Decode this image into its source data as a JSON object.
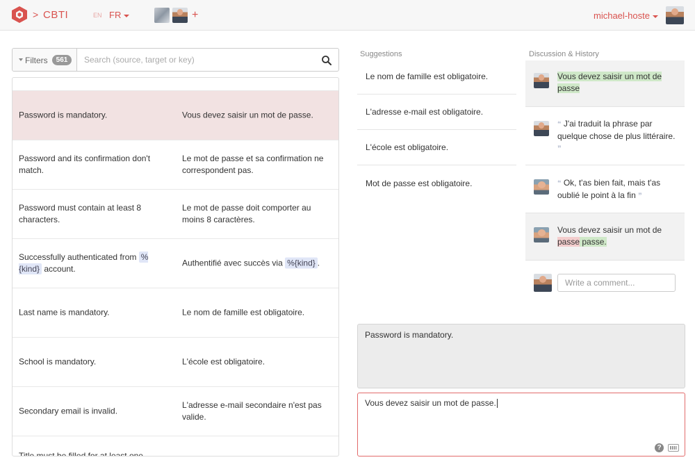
{
  "header": {
    "brand": "CBTI",
    "chevron": ">",
    "lang_inactive": "EN",
    "lang_active": "FR",
    "add": "+",
    "username": "michael-hoste"
  },
  "filters": {
    "label": "Filters",
    "count": "561",
    "search_placeholder": "Search (source, target or key)"
  },
  "translations": [
    {
      "source": "Password is mandatory.",
      "target": "Vous devez saisir un mot de passe."
    },
    {
      "source": "Password and its confirmation don't match.",
      "target": "Le mot de passe et sa confirmation ne correspondent pas."
    },
    {
      "source": "Password must contain at least 8 characters.",
      "target": "Le mot de passe doit comporter au moins 8 caractères."
    },
    {
      "source_before": "Successfully authenticated from ",
      "source_tag": "%{kind}",
      "source_after": " account.",
      "target_before": "Authentifié avec succès via ",
      "target_tag": "%{kind}",
      "target_after": "."
    },
    {
      "source": "Last name is mandatory.",
      "target": "Le nom de famille est obligatoire."
    },
    {
      "source": "School is mandatory.",
      "target": "L'école est obligatoire."
    },
    {
      "source": "Secondary email is invalid.",
      "target": "L'adresse e-mail secondaire n'est pas valide."
    },
    {
      "source": "Title must be filled for at least one",
      "target": ""
    }
  ],
  "suggestions": {
    "heading": "Suggestions",
    "items": [
      "Le nom de famille est obligatoire.",
      "L'adresse e-mail est obligatoire.",
      "L'école est obligatoire.",
      "Mot de passe est obligatoire."
    ]
  },
  "discussion": {
    "heading": "Discussion & History",
    "entries": [
      {
        "text": "Vous devez saisir un mot de passe"
      },
      {
        "open_quote": "“",
        "text": "J'ai traduit la phrase par quelque chose de plus littéraire.",
        "close_quote": "”"
      },
      {
        "open_quote": "“",
        "text": "Ok, t'as bien fait, mais t'as oublié le point à la fin",
        "close_quote": "”"
      },
      {
        "text_plain": "Vous devez saisir un mot de ",
        "text_removed": "passe",
        "text_added": " passe."
      }
    ],
    "comment_placeholder": "Write a comment..."
  },
  "editor": {
    "source": "Password is mandatory.",
    "target": "Vous devez saisir un mot de passe.",
    "help": "?"
  },
  "colors": {
    "accent": "#d9534f",
    "active_row": "#f2e2e2",
    "added_highlight": "#cfe8c8",
    "removed_highlight": "#f3cdcd"
  }
}
